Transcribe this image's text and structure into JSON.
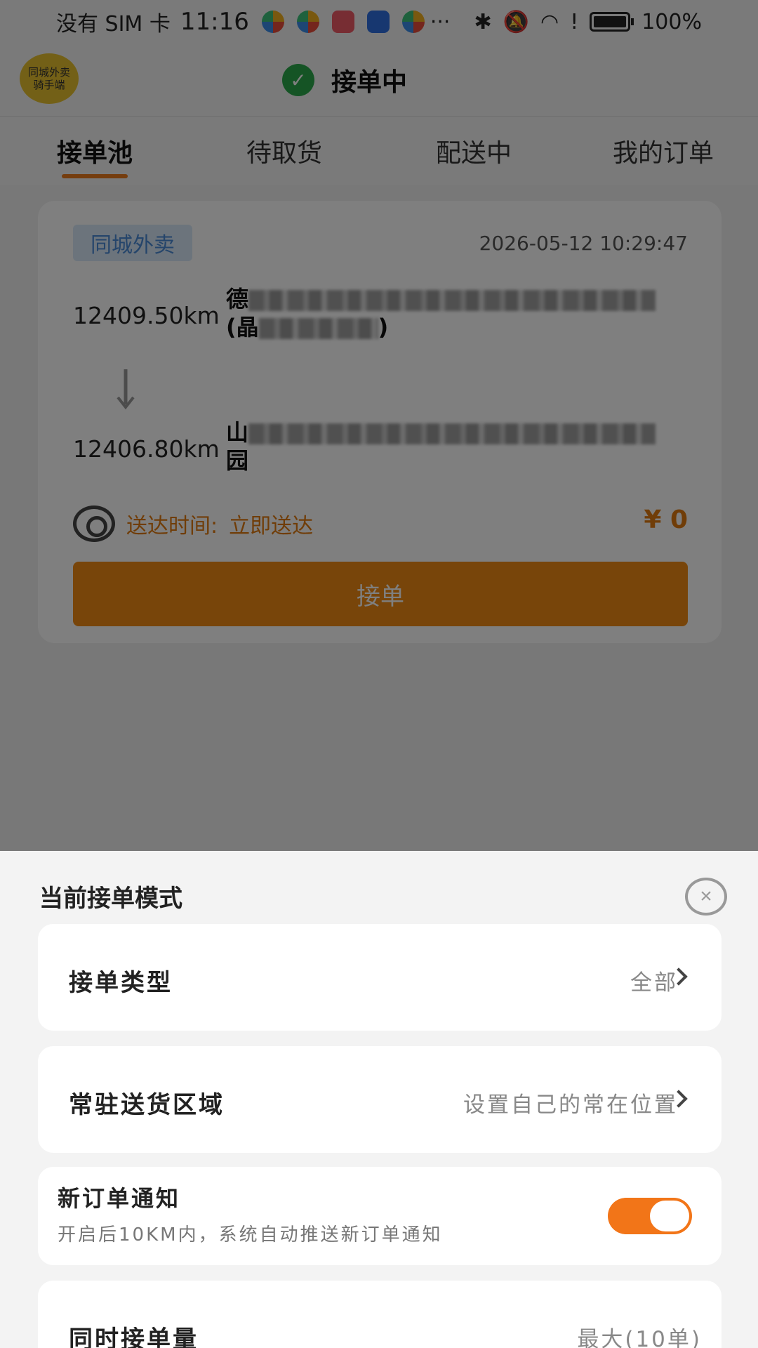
{
  "status_bar": {
    "carrier": "没有 SIM 卡",
    "time": "11:16",
    "more": "···",
    "battery": "100%"
  },
  "header": {
    "avatar_text": "同城外卖 骑手端",
    "status": "接单中"
  },
  "tabs": [
    {
      "label": "接单池",
      "active": true
    },
    {
      "label": "待取货",
      "active": false
    },
    {
      "label": "配送中",
      "active": false
    },
    {
      "label": "我的订单",
      "active": false
    }
  ],
  "order": {
    "type_badge": "同城外卖",
    "time": "2026-05-12 10:29:47",
    "pickup_distance": "12409.50km",
    "pickup_address_start": "德",
    "pickup_address_line2_start": "(晶",
    "pickup_address_line2_end": ")",
    "dropoff_distance": "12406.80km",
    "dropoff_address_start": "山",
    "dropoff_address_line2": "园",
    "delivery_label": "送达时间:",
    "delivery_value": "立即送达",
    "price": "¥ 0",
    "accept_label": "接单"
  },
  "sheet": {
    "title": "当前接单模式",
    "order_type": {
      "label": "接单类型",
      "value": "全部"
    },
    "area": {
      "label": "常驻送货区域",
      "value": "设置自己的常在位置"
    },
    "notify": {
      "title": "新订单通知",
      "subtitle": "开启后10KM内，系统自动推送新订单通知",
      "enabled": true
    },
    "capacity": {
      "label": "同时接单量",
      "value": "最大(10单)"
    }
  },
  "colors": {
    "accent": "#f08a14",
    "toggle_on": "#f27518",
    "badge_text": "#4a8bd6",
    "online_check": "#2aa84a"
  }
}
